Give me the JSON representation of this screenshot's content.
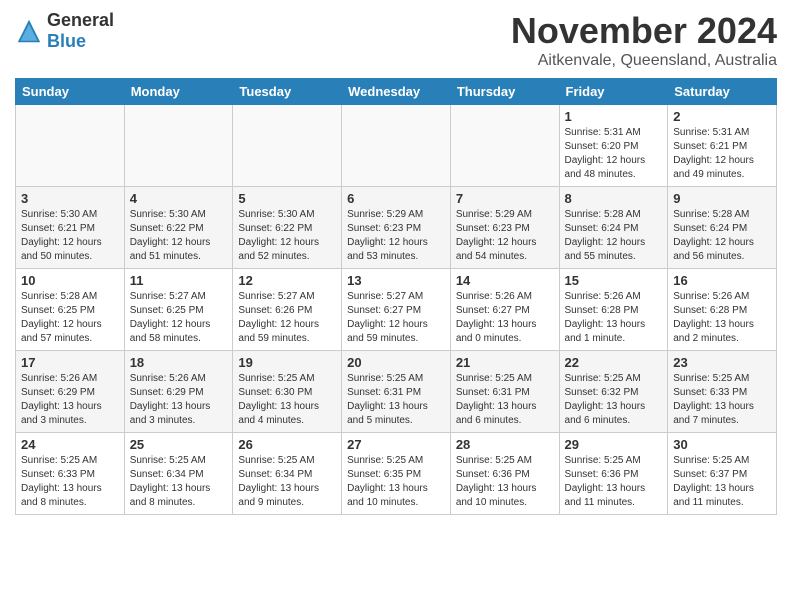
{
  "header": {
    "logo_general": "General",
    "logo_blue": "Blue",
    "month_title": "November 2024",
    "location": "Aitkenvale, Queensland, Australia"
  },
  "days_of_week": [
    "Sunday",
    "Monday",
    "Tuesday",
    "Wednesday",
    "Thursday",
    "Friday",
    "Saturday"
  ],
  "weeks": [
    [
      {
        "day": "",
        "info": ""
      },
      {
        "day": "",
        "info": ""
      },
      {
        "day": "",
        "info": ""
      },
      {
        "day": "",
        "info": ""
      },
      {
        "day": "",
        "info": ""
      },
      {
        "day": "1",
        "info": "Sunrise: 5:31 AM\nSunset: 6:20 PM\nDaylight: 12 hours\nand 48 minutes."
      },
      {
        "day": "2",
        "info": "Sunrise: 5:31 AM\nSunset: 6:21 PM\nDaylight: 12 hours\nand 49 minutes."
      }
    ],
    [
      {
        "day": "3",
        "info": "Sunrise: 5:30 AM\nSunset: 6:21 PM\nDaylight: 12 hours\nand 50 minutes."
      },
      {
        "day": "4",
        "info": "Sunrise: 5:30 AM\nSunset: 6:22 PM\nDaylight: 12 hours\nand 51 minutes."
      },
      {
        "day": "5",
        "info": "Sunrise: 5:30 AM\nSunset: 6:22 PM\nDaylight: 12 hours\nand 52 minutes."
      },
      {
        "day": "6",
        "info": "Sunrise: 5:29 AM\nSunset: 6:23 PM\nDaylight: 12 hours\nand 53 minutes."
      },
      {
        "day": "7",
        "info": "Sunrise: 5:29 AM\nSunset: 6:23 PM\nDaylight: 12 hours\nand 54 minutes."
      },
      {
        "day": "8",
        "info": "Sunrise: 5:28 AM\nSunset: 6:24 PM\nDaylight: 12 hours\nand 55 minutes."
      },
      {
        "day": "9",
        "info": "Sunrise: 5:28 AM\nSunset: 6:24 PM\nDaylight: 12 hours\nand 56 minutes."
      }
    ],
    [
      {
        "day": "10",
        "info": "Sunrise: 5:28 AM\nSunset: 6:25 PM\nDaylight: 12 hours\nand 57 minutes."
      },
      {
        "day": "11",
        "info": "Sunrise: 5:27 AM\nSunset: 6:25 PM\nDaylight: 12 hours\nand 58 minutes."
      },
      {
        "day": "12",
        "info": "Sunrise: 5:27 AM\nSunset: 6:26 PM\nDaylight: 12 hours\nand 59 minutes."
      },
      {
        "day": "13",
        "info": "Sunrise: 5:27 AM\nSunset: 6:27 PM\nDaylight: 12 hours\nand 59 minutes."
      },
      {
        "day": "14",
        "info": "Sunrise: 5:26 AM\nSunset: 6:27 PM\nDaylight: 13 hours\nand 0 minutes."
      },
      {
        "day": "15",
        "info": "Sunrise: 5:26 AM\nSunset: 6:28 PM\nDaylight: 13 hours\nand 1 minute."
      },
      {
        "day": "16",
        "info": "Sunrise: 5:26 AM\nSunset: 6:28 PM\nDaylight: 13 hours\nand 2 minutes."
      }
    ],
    [
      {
        "day": "17",
        "info": "Sunrise: 5:26 AM\nSunset: 6:29 PM\nDaylight: 13 hours\nand 3 minutes."
      },
      {
        "day": "18",
        "info": "Sunrise: 5:26 AM\nSunset: 6:29 PM\nDaylight: 13 hours\nand 3 minutes."
      },
      {
        "day": "19",
        "info": "Sunrise: 5:25 AM\nSunset: 6:30 PM\nDaylight: 13 hours\nand 4 minutes."
      },
      {
        "day": "20",
        "info": "Sunrise: 5:25 AM\nSunset: 6:31 PM\nDaylight: 13 hours\nand 5 minutes."
      },
      {
        "day": "21",
        "info": "Sunrise: 5:25 AM\nSunset: 6:31 PM\nDaylight: 13 hours\nand 6 minutes."
      },
      {
        "day": "22",
        "info": "Sunrise: 5:25 AM\nSunset: 6:32 PM\nDaylight: 13 hours\nand 6 minutes."
      },
      {
        "day": "23",
        "info": "Sunrise: 5:25 AM\nSunset: 6:33 PM\nDaylight: 13 hours\nand 7 minutes."
      }
    ],
    [
      {
        "day": "24",
        "info": "Sunrise: 5:25 AM\nSunset: 6:33 PM\nDaylight: 13 hours\nand 8 minutes."
      },
      {
        "day": "25",
        "info": "Sunrise: 5:25 AM\nSunset: 6:34 PM\nDaylight: 13 hours\nand 8 minutes."
      },
      {
        "day": "26",
        "info": "Sunrise: 5:25 AM\nSunset: 6:34 PM\nDaylight: 13 hours\nand 9 minutes."
      },
      {
        "day": "27",
        "info": "Sunrise: 5:25 AM\nSunset: 6:35 PM\nDaylight: 13 hours\nand 10 minutes."
      },
      {
        "day": "28",
        "info": "Sunrise: 5:25 AM\nSunset: 6:36 PM\nDaylight: 13 hours\nand 10 minutes."
      },
      {
        "day": "29",
        "info": "Sunrise: 5:25 AM\nSunset: 6:36 PM\nDaylight: 13 hours\nand 11 minutes."
      },
      {
        "day": "30",
        "info": "Sunrise: 5:25 AM\nSunset: 6:37 PM\nDaylight: 13 hours\nand 11 minutes."
      }
    ]
  ]
}
